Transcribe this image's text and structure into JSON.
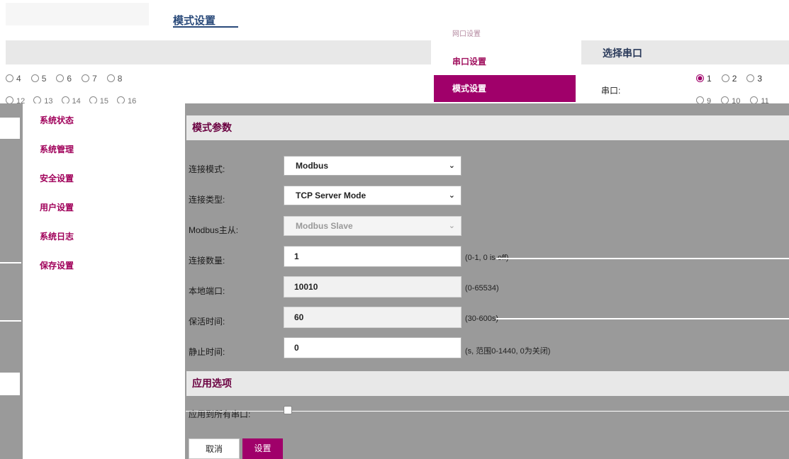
{
  "background": {
    "page_title": "模式设置",
    "nav_items": [
      {
        "label": "网口设置",
        "state": "faded"
      },
      {
        "label": "串口设置",
        "state": "normal"
      },
      {
        "label": "模式设置",
        "state": "active"
      }
    ],
    "radios_row1": [
      "4",
      "5",
      "6",
      "7",
      "8"
    ],
    "radios_row2": [
      "12",
      "13",
      "14",
      "15",
      "16"
    ],
    "right_panel": {
      "title": "选择串口",
      "port_label": "串口:",
      "radios_row1": [
        "1",
        "2",
        "3"
      ],
      "radios_row1_selected": "1",
      "radios_row2": [
        "9",
        "10",
        "11"
      ]
    }
  },
  "sidebar": {
    "items": [
      "系统状态",
      "系统管理",
      "安全设置",
      "用户设置",
      "系统日志",
      "保存设置"
    ]
  },
  "form": {
    "section_mode": "模式参数",
    "conn_mode": {
      "label": "连接模式:",
      "value": "Modbus"
    },
    "conn_type": {
      "label": "连接类型:",
      "value": "TCP Server Mode"
    },
    "modbus_role": {
      "label": "Modbus主从:",
      "value": "Modbus Slave"
    },
    "conn_count": {
      "label": "连接数量:",
      "value": "1",
      "hint": "(0-1, 0 is off)"
    },
    "local_port": {
      "label": "本地端口:",
      "value": "10010",
      "hint": "(0-65534)"
    },
    "keepalive": {
      "label": "保活时间:",
      "value": "60",
      "hint": "(30-600s)"
    },
    "idle_time": {
      "label": "静止时间:",
      "value": "0",
      "hint": "(s, 范围0-1440, 0为关闭)"
    },
    "section_apply": "应用选项",
    "apply_all": {
      "label": "应用到所有串口:",
      "checked": false
    }
  },
  "buttons": {
    "cancel": "取消",
    "submit": "设置"
  },
  "colors": {
    "accent": "#a0006a",
    "overlay": "#9a9a9a",
    "section_band": "#e8e8e8"
  }
}
